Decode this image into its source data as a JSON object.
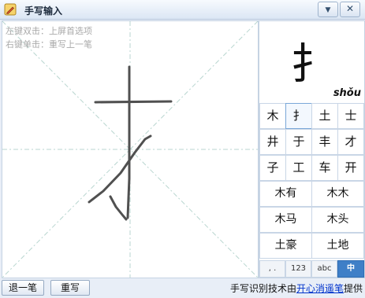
{
  "window": {
    "title": "手写输入",
    "minimize_icon": "▼",
    "close_icon": "✕"
  },
  "hints": [
    "左键双击：上屏首选项",
    "右键单击：重写上一笔"
  ],
  "preview": {
    "char": "扌",
    "pinyin": "shǒu"
  },
  "candidates": {
    "chars": [
      "木",
      "扌",
      "土",
      "士",
      "井",
      "于",
      "丰",
      "才",
      "子",
      "工",
      "车",
      "开"
    ],
    "words": [
      "木有",
      "木木",
      "木马",
      "木头",
      "土豪",
      "土地"
    ]
  },
  "mode_tabs": [
    ", .",
    "123",
    "abc",
    "中"
  ],
  "status": {
    "undo_label": "退一笔",
    "rewrite_label": "重写",
    "credit_prefix": "手写识别技术由",
    "credit_link": "开心消遥笔",
    "credit_suffix": "提供"
  },
  "colors": {
    "accent": "#3f7fc7",
    "ink": "#505050",
    "guide": "#b9d6d0"
  }
}
